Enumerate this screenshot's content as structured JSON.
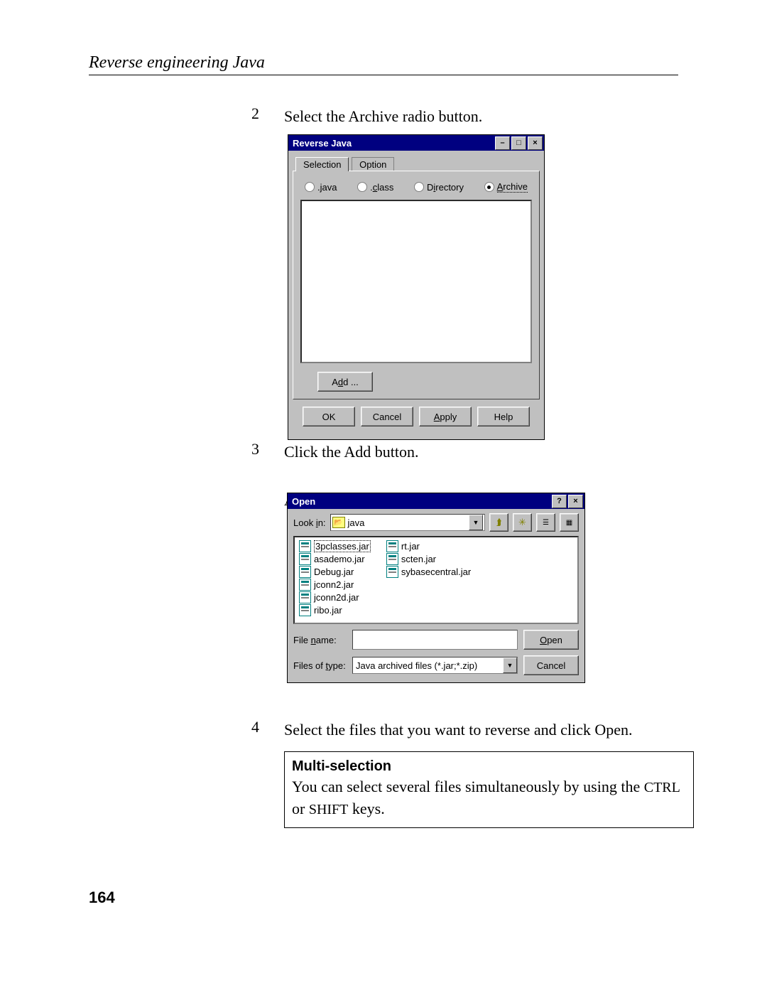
{
  "header": {
    "title": "Reverse engineering Java"
  },
  "page_number": "164",
  "steps": [
    {
      "num": "2",
      "text": "Select the Archive radio button."
    },
    {
      "num": "3",
      "text": "Click the Add button.",
      "text2": "A standard Open dialog box appears."
    },
    {
      "num": "4",
      "text": "Select the files that you want to reverse and click Open."
    }
  ],
  "dialog1": {
    "title": "Reverse Java",
    "tabs": [
      "Selection",
      "Option"
    ],
    "radios": [
      ".java",
      ".class",
      "Directory",
      "Archive"
    ],
    "selected_radio": "Archive",
    "add_label": "Add ...",
    "buttons": {
      "ok": "OK",
      "cancel": "Cancel",
      "apply": "Apply",
      "help": "Help"
    }
  },
  "dialog2": {
    "title": "Open",
    "lookin_label": "Look in:",
    "lookin": "java",
    "files": [
      "3pclasses.jar",
      "asademo.jar",
      "Debug.jar",
      "jconn2.jar",
      "jconn2d.jar",
      "ribo.jar",
      "rt.jar",
      "scten.jar",
      "sybasecentral.jar"
    ],
    "selected_file": "3pclasses.jar",
    "filename_label": "File name:",
    "filename": "",
    "filetype_label": "Files of type:",
    "filetype": "Java archived files (*.jar;*.zip)",
    "open": "Open",
    "cancel": "Cancel"
  },
  "note": {
    "title": "Multi-selection",
    "body": "You can select several files simultaneously by using the CTRL or SHIFT keys."
  }
}
